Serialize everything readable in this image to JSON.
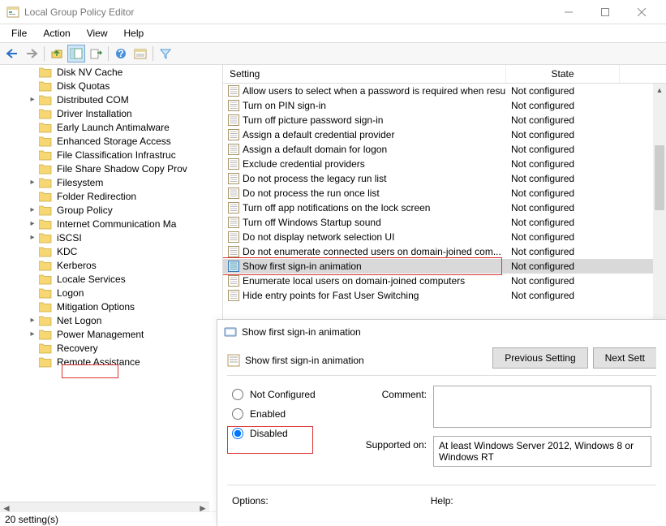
{
  "window": {
    "title": "Local Group Policy Editor"
  },
  "menu": {
    "file": "File",
    "action": "Action",
    "view": "View",
    "help": "Help"
  },
  "tree": {
    "items": [
      {
        "label": "Disk NV Cache",
        "expander": ""
      },
      {
        "label": "Disk Quotas",
        "expander": ""
      },
      {
        "label": "Distributed COM",
        "expander": ">"
      },
      {
        "label": "Driver Installation",
        "expander": ""
      },
      {
        "label": "Early Launch Antimalware",
        "expander": ""
      },
      {
        "label": "Enhanced Storage Access",
        "expander": ""
      },
      {
        "label": "File Classification Infrastruc",
        "expander": ""
      },
      {
        "label": "File Share Shadow Copy Prov",
        "expander": ""
      },
      {
        "label": "Filesystem",
        "expander": ">"
      },
      {
        "label": "Folder Redirection",
        "expander": ""
      },
      {
        "label": "Group Policy",
        "expander": ">"
      },
      {
        "label": "Internet Communication Ma",
        "expander": ">"
      },
      {
        "label": "iSCSI",
        "expander": ">"
      },
      {
        "label": "KDC",
        "expander": ""
      },
      {
        "label": "Kerberos",
        "expander": ""
      },
      {
        "label": "Locale Services",
        "expander": ""
      },
      {
        "label": "Logon",
        "expander": ""
      },
      {
        "label": "Mitigation Options",
        "expander": ""
      },
      {
        "label": "Net Logon",
        "expander": ">"
      },
      {
        "label": "Power Management",
        "expander": ">"
      },
      {
        "label": "Recovery",
        "expander": ""
      },
      {
        "label": "Remote Assistance",
        "expander": ""
      }
    ]
  },
  "status": "20 setting(s)",
  "list": {
    "col_setting": "Setting",
    "col_state": "State",
    "rows": [
      {
        "name": "Allow users to select when a password is required when resu...",
        "state": "Not configured"
      },
      {
        "name": "Turn on PIN sign-in",
        "state": "Not configured"
      },
      {
        "name": "Turn off picture password sign-in",
        "state": "Not configured"
      },
      {
        "name": "Assign a default credential provider",
        "state": "Not configured"
      },
      {
        "name": "Assign a default domain for logon",
        "state": "Not configured"
      },
      {
        "name": "Exclude credential providers",
        "state": "Not configured"
      },
      {
        "name": "Do not process the legacy run list",
        "state": "Not configured"
      },
      {
        "name": "Do not process the run once list",
        "state": "Not configured"
      },
      {
        "name": "Turn off app notifications on the lock screen",
        "state": "Not configured"
      },
      {
        "name": "Turn off Windows Startup sound",
        "state": "Not configured"
      },
      {
        "name": "Do not display network selection UI",
        "state": "Not configured"
      },
      {
        "name": "Do not enumerate connected users on domain-joined com...",
        "state": "Not configured"
      },
      {
        "name": "Show first sign-in animation",
        "state": "Not configured"
      },
      {
        "name": "Enumerate local users on domain-joined computers",
        "state": "Not configured"
      },
      {
        "name": "Hide entry points for Fast User Switching",
        "state": "Not configured"
      }
    ]
  },
  "dialog": {
    "title": "Show first sign-in animation",
    "heading": "Show first sign-in animation",
    "prev_btn": "Previous Setting",
    "next_btn": "Next Sett",
    "opt_not_configured": "Not Configured",
    "opt_enabled": "Enabled",
    "opt_disabled": "Disabled",
    "comment_label": "Comment:",
    "supported_label": "Supported on:",
    "supported_value": "At least Windows Server 2012, Windows 8 or Windows RT",
    "options_label": "Options:",
    "help_label": "Help:"
  }
}
